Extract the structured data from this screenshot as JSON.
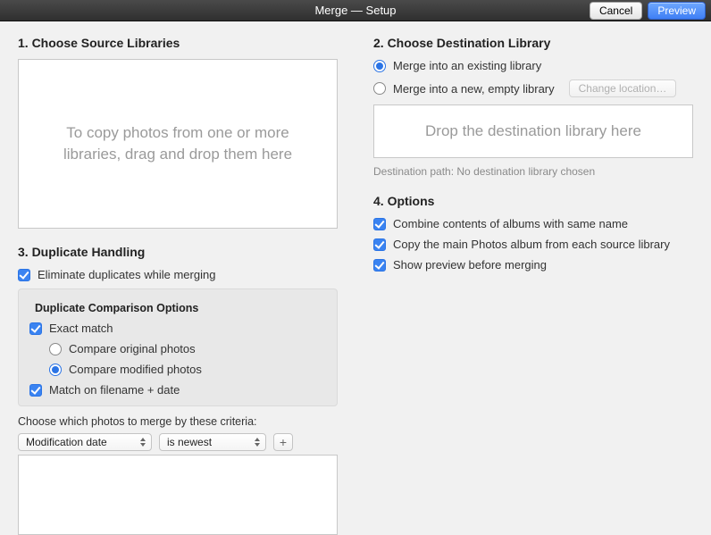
{
  "titlebar": {
    "title": "Merge — Setup",
    "cancel": "Cancel",
    "preview": "Preview"
  },
  "source": {
    "heading": "1. Choose Source Libraries",
    "drop_hint": "To copy photos from one or more libraries, drag and drop them here"
  },
  "destination": {
    "heading": "2. Choose Destination Library",
    "opt_existing": "Merge into an existing library",
    "opt_new": "Merge into a new, empty library",
    "change_location": "Change location…",
    "drop_hint": "Drop the destination library here",
    "path_label": "Destination path: No destination library chosen"
  },
  "dup": {
    "heading": "3. Duplicate Handling",
    "eliminate": "Eliminate duplicates while merging",
    "compare_hdr": "Duplicate Comparison Options",
    "exact": "Exact match",
    "compare_original": "Compare original photos",
    "compare_modified": "Compare modified photos",
    "match_filename": "Match on filename + date",
    "criteria_label": "Choose which photos to merge by these criteria:",
    "criteria_field": "Modification date",
    "criteria_op": "is newest"
  },
  "options": {
    "heading": "4. Options",
    "combine": "Combine contents of albums with same name",
    "copy_main": "Copy the main Photos album from each source library",
    "show_preview": "Show preview before merging"
  }
}
